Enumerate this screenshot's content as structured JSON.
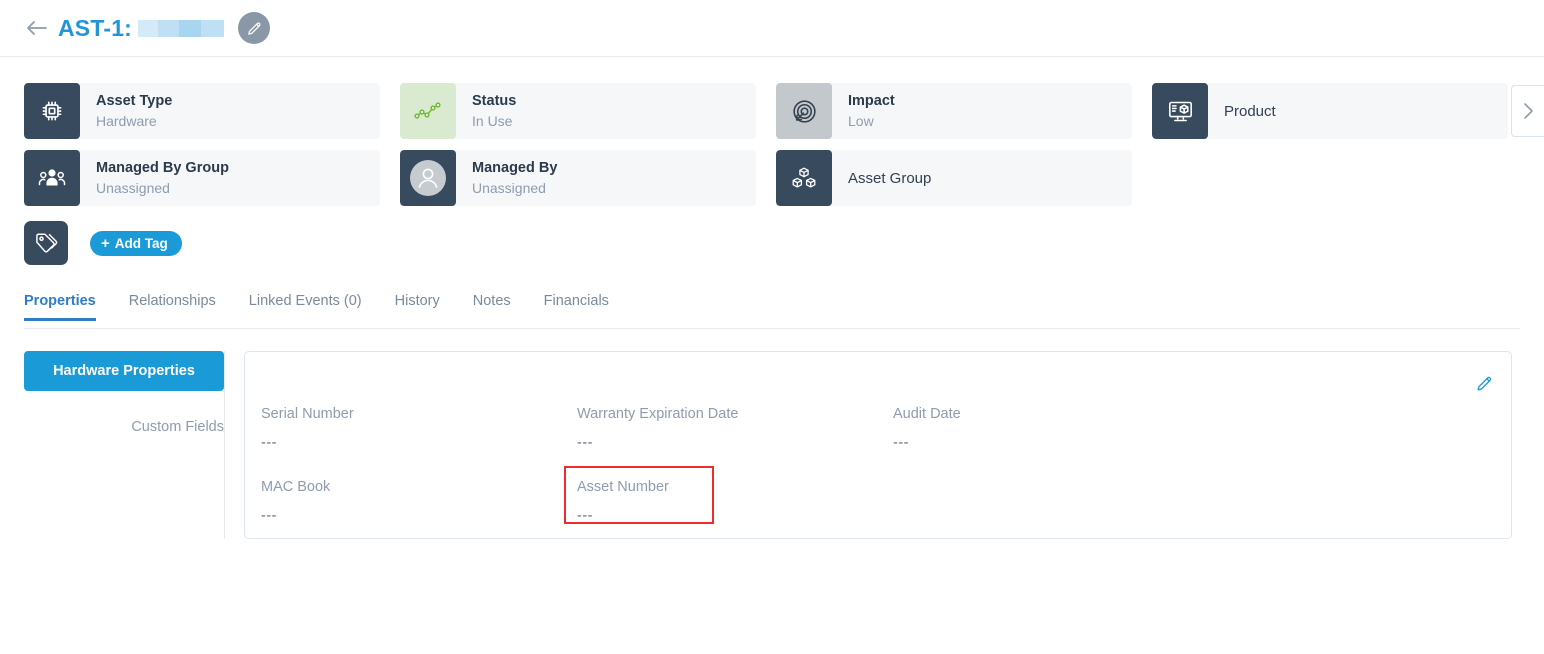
{
  "header": {
    "back_icon": "arrow-left-icon",
    "asset_id": "AST-1:",
    "title_redacted": true,
    "edit_icon": "pencil-icon"
  },
  "cards": {
    "row1": [
      {
        "icon": "chip-icon",
        "tile": "dark",
        "title": "Asset Type",
        "subtitle": "Hardware"
      },
      {
        "icon": "trend-chart-icon",
        "tile": "green",
        "title": "Status",
        "subtitle": "In Use"
      },
      {
        "icon": "target-arrow-icon",
        "tile": "grey",
        "title": "Impact",
        "subtitle": "Low"
      },
      {
        "icon": "monitor-product-icon",
        "tile": "dark",
        "title": "Product",
        "subtitle": ""
      }
    ],
    "row2": [
      {
        "icon": "people-group-icon",
        "tile": "dark",
        "title": "Managed By Group",
        "subtitle": "Unassigned"
      },
      {
        "icon": "user-avatar-icon",
        "tile": "dark",
        "title": "Managed By",
        "subtitle": "Unassigned"
      },
      {
        "icon": "boxes-icon",
        "tile": "dark",
        "title": "Asset Group",
        "subtitle": ""
      }
    ],
    "scroll_next_icon": "chevron-right-icon"
  },
  "tags": {
    "tag_icon": "tags-icon",
    "add_label": "Add Tag",
    "add_plus": "+"
  },
  "tabs": [
    {
      "label": "Properties",
      "active": true
    },
    {
      "label": "Relationships",
      "active": false
    },
    {
      "label": "Linked Events (0)",
      "active": false
    },
    {
      "label": "History",
      "active": false
    },
    {
      "label": "Notes",
      "active": false
    },
    {
      "label": "Financials",
      "active": false
    }
  ],
  "subnav": {
    "active_label": "Hardware Properties",
    "plain_label": "Custom Fields"
  },
  "panel": {
    "edit_icon": "pencil-icon",
    "empty_value": "---",
    "row1": [
      {
        "label": "Serial Number",
        "value": "---"
      },
      {
        "label": "Warranty Expiration Date",
        "value": "---"
      },
      {
        "label": "Audit Date",
        "value": "---"
      }
    ],
    "row2": [
      {
        "label": "MAC Book",
        "value": "---",
        "highlighted": false
      },
      {
        "label": "Asset Number",
        "value": "---",
        "highlighted": true
      }
    ]
  },
  "colors": {
    "accent_blue": "#1a9ad7",
    "tab_blue": "#2f7dc4",
    "tile_dark": "#384a5e",
    "tile_green": "#d9ead0",
    "tile_grey": "#c2c8cc",
    "highlight_red": "#ef2b2b",
    "card_bg": "#f5f7f9"
  }
}
